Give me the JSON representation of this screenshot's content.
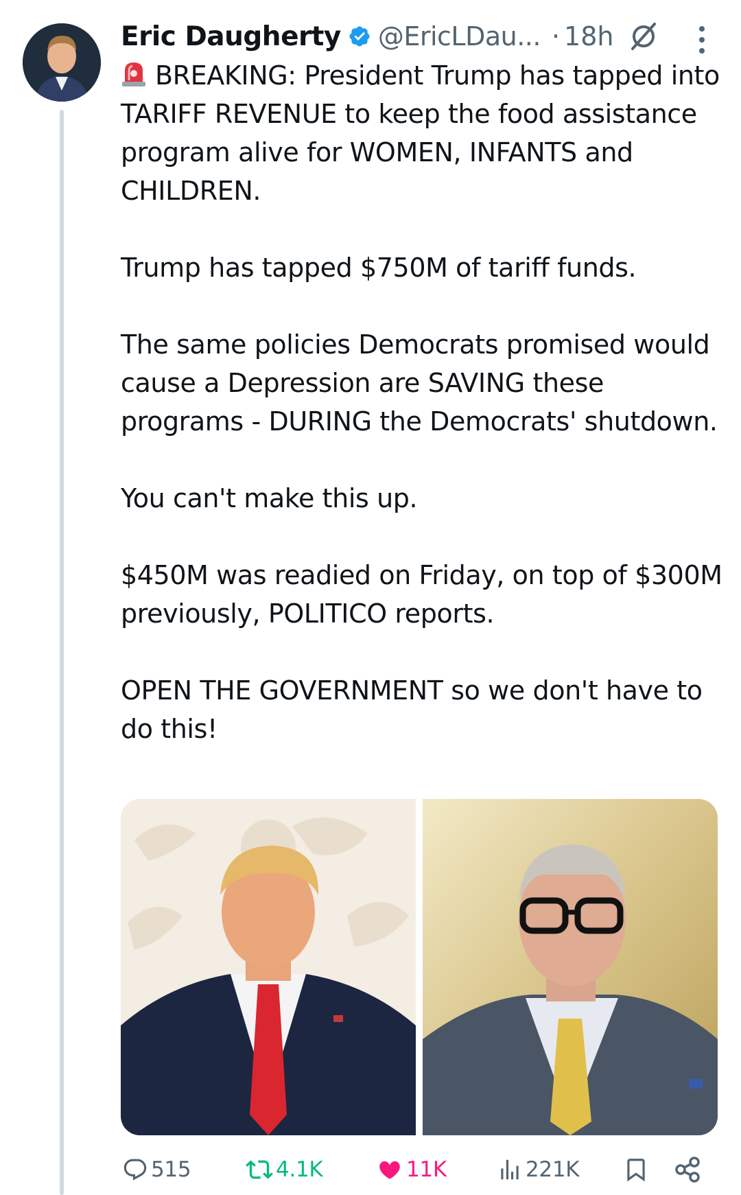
{
  "tweet": {
    "author": {
      "name": "Eric Daugherty",
      "handle": "@EricLDau...",
      "verified": true,
      "avatar_icon": "profile-photo"
    },
    "time": "18h",
    "separator": "·",
    "text": {
      "p1": "BREAKING: President Trump has tapped into TARIFF REVENUE to keep the food assistance program alive for WOMEN, INFANTS and CHILDREN.",
      "p2": "Trump has tapped $750M of tariff funds.",
      "p3": "The same policies Democrats promised would cause a Depression are SAVING these programs - DURING the Democrats' shutdown.",
      "p4": "You can't make this up.",
      "p5": "$450M was readied on Friday, on top of $300M previously, POLITICO reports.",
      "p6": "OPEN THE GOVERNMENT so we don't have to do this!"
    },
    "media": [
      {
        "icon": "photo-man-red-tie"
      },
      {
        "icon": "photo-man-glasses-yellow-tie"
      }
    ],
    "stats": {
      "replies": "515",
      "reposts": "4.1K",
      "likes": "11K",
      "views": "221K"
    }
  },
  "colors": {
    "text": "#0f1419",
    "secondary": "#536471",
    "verified": "#1d9bf0",
    "repost_active": "#00ba7c",
    "like_active": "#f91880",
    "thread_line": "#cfd9de"
  },
  "icons": {
    "siren": "siren-emoji-icon",
    "verified": "verified-badge-icon",
    "grok": "grok-icon",
    "more": "more-vertical-icon",
    "reply": "reply-icon",
    "repost": "repost-icon",
    "like": "heart-icon",
    "views": "views-icon",
    "bookmark": "bookmark-icon",
    "share": "share-icon"
  }
}
